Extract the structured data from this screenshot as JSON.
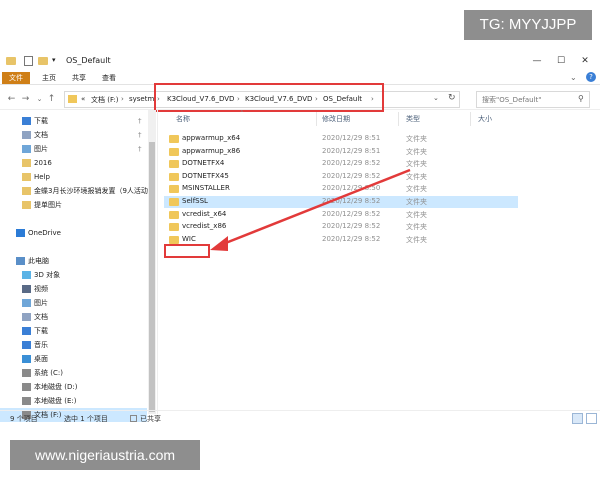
{
  "watermark": {
    "top": "TG: MYYJJPP",
    "bottom": "www.nigeriaustria.com"
  },
  "window": {
    "title": "OS_Default",
    "controls": [
      "—",
      "☐",
      "✕"
    ]
  },
  "ribbon": {
    "tabs": [
      "文件",
      "主页",
      "共享",
      "查看"
    ]
  },
  "address": {
    "prefix": "«",
    "crumbs": [
      "文档 (F:)",
      "sysetm",
      "K3Cloud_V7.6_DVD",
      "K3Cloud_V7.6_DVD",
      "OS_Default"
    ],
    "search_placeholder": "搜索\"OS_Default\""
  },
  "sidebar": {
    "items": [
      {
        "label": "下载",
        "icon": "download-icon",
        "indent": 1,
        "pin": true
      },
      {
        "label": "文档",
        "icon": "documents-icon",
        "indent": 1,
        "pin": true
      },
      {
        "label": "图片",
        "icon": "pictures-icon",
        "indent": 1,
        "pin": true
      },
      {
        "label": "2016",
        "icon": "folder-icon",
        "indent": 1,
        "pin": false
      },
      {
        "label": "Help",
        "icon": "folder-icon",
        "indent": 1,
        "pin": false
      },
      {
        "label": "金蝶3月长沙环境报销发置（9人活动",
        "icon": "folder-icon",
        "indent": 1,
        "pin": false
      },
      {
        "label": "提单图片",
        "icon": "folder-icon",
        "indent": 1,
        "pin": false
      },
      {
        "label": "",
        "icon": "",
        "indent": 0,
        "pin": false
      },
      {
        "label": "OneDrive",
        "icon": "onedrive-icon",
        "indent": 0,
        "pin": false
      },
      {
        "label": "",
        "icon": "",
        "indent": 0,
        "pin": false
      },
      {
        "label": "此电脑",
        "icon": "this-pc-icon",
        "indent": 0,
        "pin": false
      },
      {
        "label": "3D 对象",
        "icon": "3d-objects-icon",
        "indent": 1,
        "pin": false
      },
      {
        "label": "视频",
        "icon": "video-icon",
        "indent": 1,
        "pin": false
      },
      {
        "label": "图片",
        "icon": "pictures-icon",
        "indent": 1,
        "pin": false
      },
      {
        "label": "文档",
        "icon": "documents-icon",
        "indent": 1,
        "pin": false
      },
      {
        "label": "下载",
        "icon": "download-icon",
        "indent": 1,
        "pin": false
      },
      {
        "label": "音乐",
        "icon": "music-icon",
        "indent": 1,
        "pin": false
      },
      {
        "label": "桌面",
        "icon": "desktop-icon",
        "indent": 1,
        "pin": false
      },
      {
        "label": "系统 (C:)",
        "icon": "drive-icon",
        "indent": 1,
        "pin": false
      },
      {
        "label": "本地磁盘 (D:)",
        "icon": "drive-icon",
        "indent": 1,
        "pin": false
      },
      {
        "label": "本地磁盘 (E:)",
        "icon": "drive-icon",
        "indent": 1,
        "pin": false
      },
      {
        "label": "文档 (F:)",
        "icon": "drive-icon",
        "indent": 1,
        "pin": false,
        "selected": true
      }
    ]
  },
  "columns": {
    "name": "名称",
    "date": "修改日期",
    "type": "类型",
    "size": "大小"
  },
  "files": [
    {
      "name": "appwarmup_x64",
      "date": "2020/12/29 8:51",
      "type": "文件夹"
    },
    {
      "name": "appwarmup_x86",
      "date": "2020/12/29 8:51",
      "type": "文件夹"
    },
    {
      "name": "DOTNETFX4",
      "date": "2020/12/29 8:52",
      "type": "文件夹"
    },
    {
      "name": "DOTNETFX45",
      "date": "2020/12/29 8:52",
      "type": "文件夹"
    },
    {
      "name": "MSINSTALLER",
      "date": "2020/12/29 8:50",
      "type": "文件夹"
    },
    {
      "name": "SelfSSL",
      "date": "2020/12/29 8:52",
      "type": "文件夹",
      "selected": true
    },
    {
      "name": "vcredist_x64",
      "date": "2020/12/29 8:52",
      "type": "文件夹"
    },
    {
      "name": "vcredist_x86",
      "date": "2020/12/29 8:52",
      "type": "文件夹"
    },
    {
      "name": "WIC",
      "date": "2020/12/29 8:52",
      "type": "文件夹"
    }
  ],
  "status": {
    "count": "9 个项目",
    "selected": "选中 1 个项目",
    "state": "已共享"
  },
  "colors": {
    "accent": "#cf7f17",
    "highlight": "#e23a3a",
    "selection": "#cce8ff",
    "folder": "#f0c75a"
  }
}
